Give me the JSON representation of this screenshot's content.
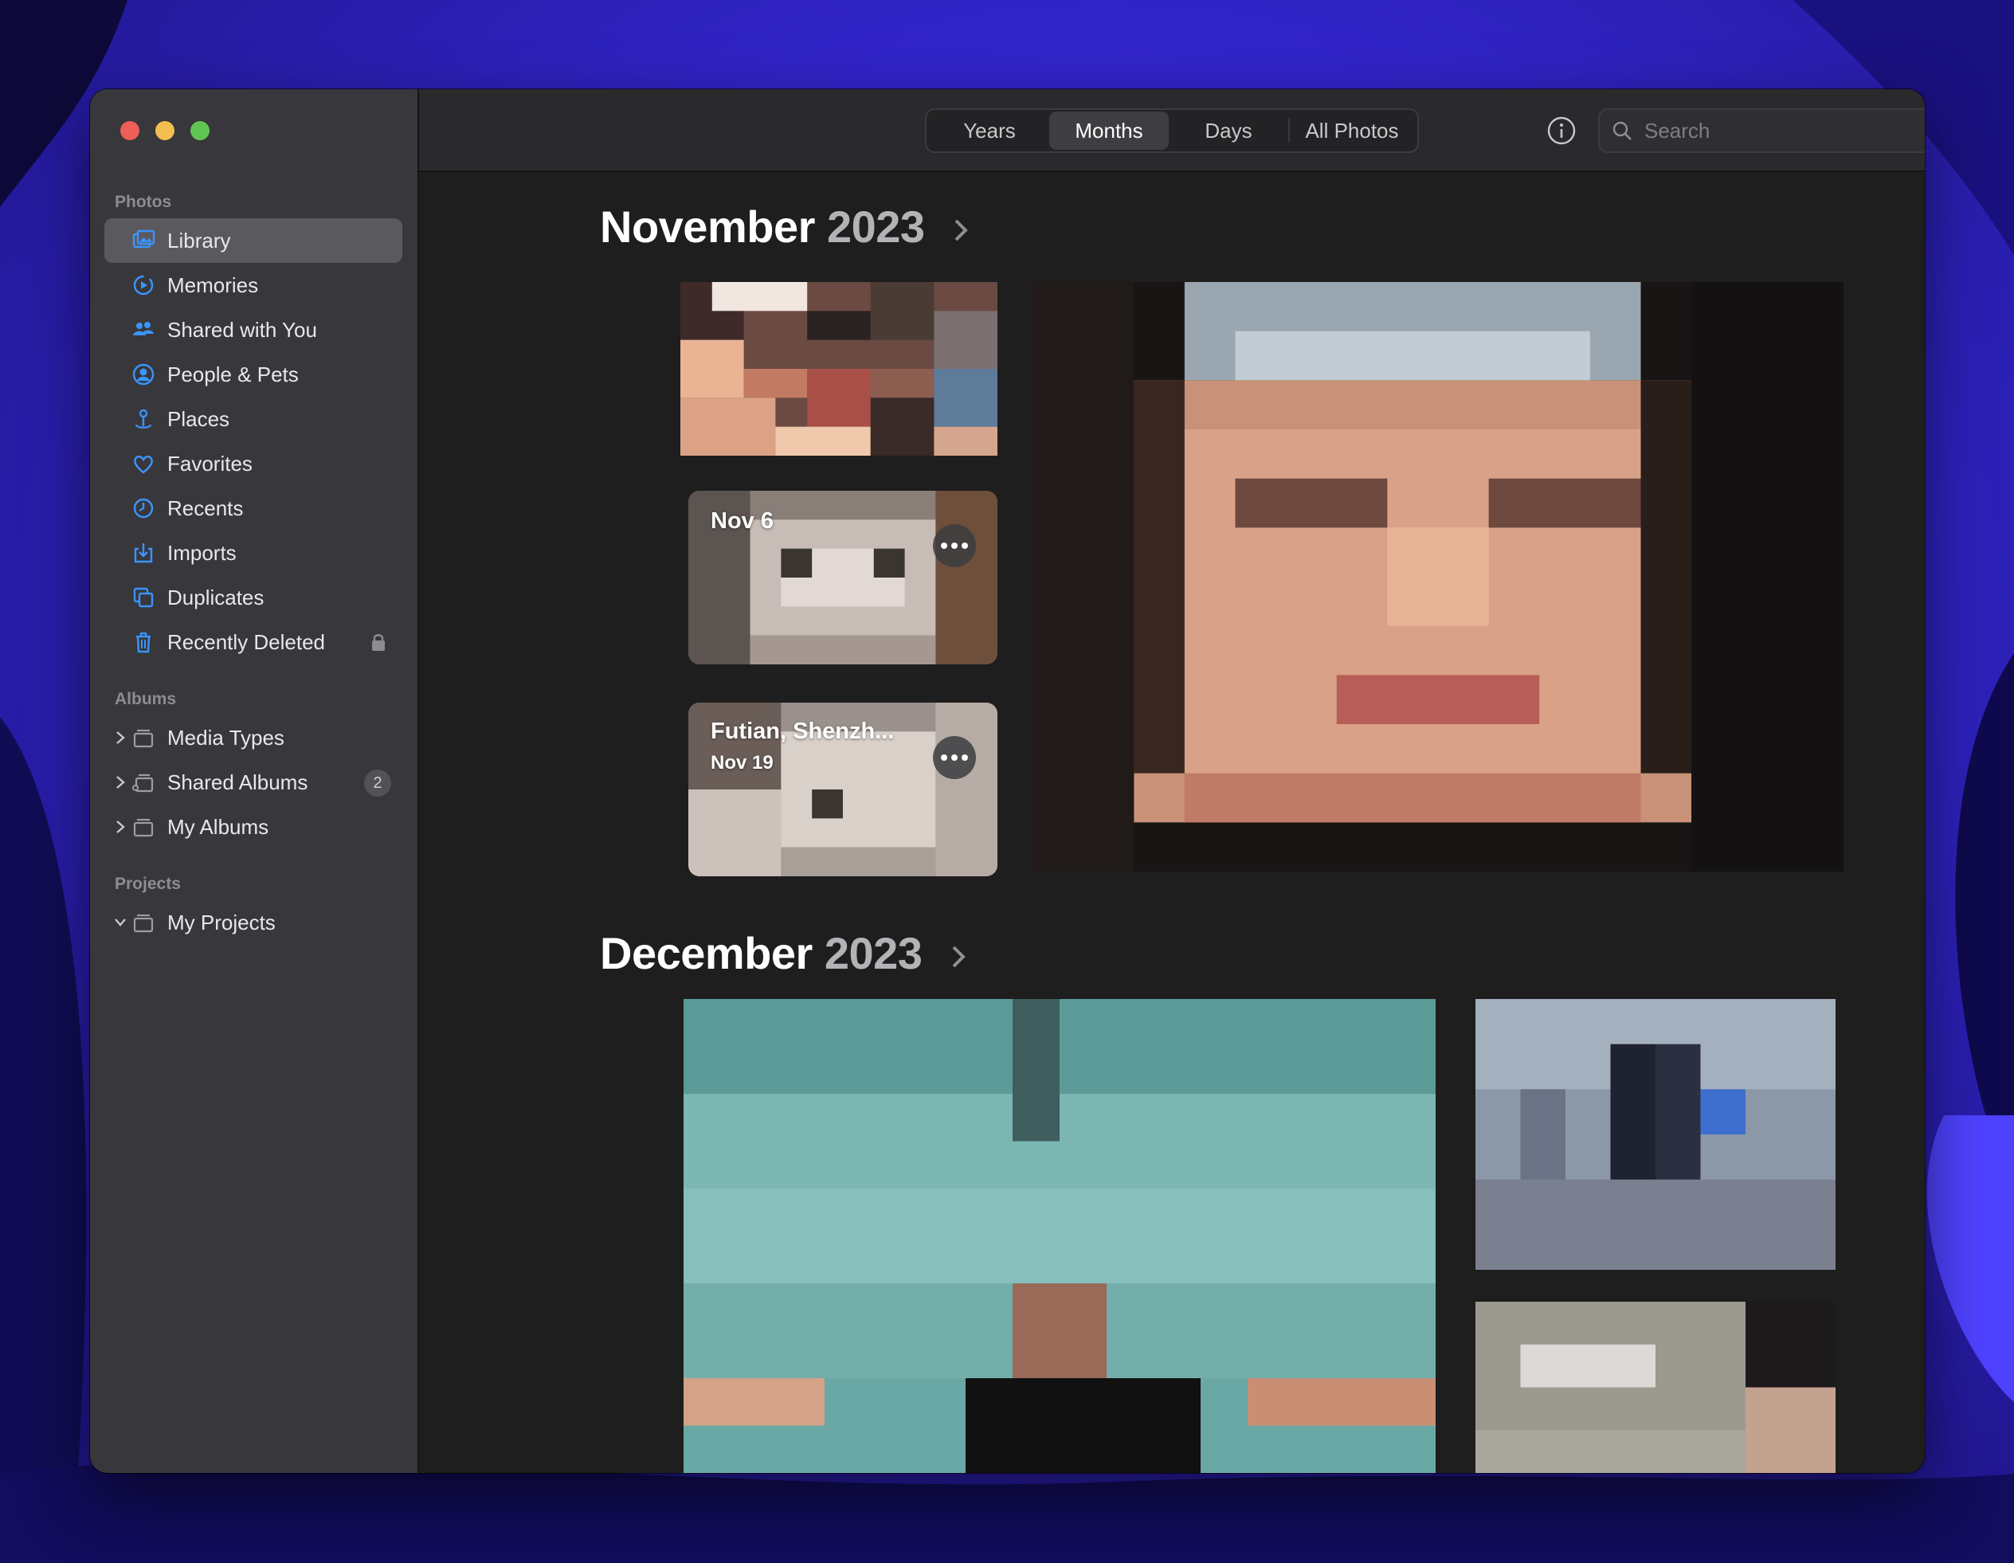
{
  "window": {
    "traffic_lights": [
      "close",
      "minimize",
      "zoom"
    ]
  },
  "sidebar": {
    "photos_section": "Photos",
    "items": [
      {
        "label": "Library",
        "icon": "library-icon"
      },
      {
        "label": "Memories",
        "icon": "memories-icon"
      },
      {
        "label": "Shared with You",
        "icon": "shared-with-you-icon"
      },
      {
        "label": "People & Pets",
        "icon": "people-icon"
      },
      {
        "label": "Places",
        "icon": "places-icon"
      },
      {
        "label": "Favorites",
        "icon": "heart-icon"
      },
      {
        "label": "Recents",
        "icon": "clock-icon"
      },
      {
        "label": "Imports",
        "icon": "import-icon"
      },
      {
        "label": "Duplicates",
        "icon": "duplicates-icon"
      },
      {
        "label": "Recently Deleted",
        "icon": "trash-icon"
      }
    ],
    "albums_section": "Albums",
    "albums": [
      {
        "label": "Media Types",
        "icon": "album-stack-icon"
      },
      {
        "label": "Shared Albums",
        "icon": "shared-album-icon",
        "badge": "2"
      },
      {
        "label": "My Albums",
        "icon": "album-stack-icon"
      }
    ],
    "projects_section": "Projects",
    "projects": [
      {
        "label": "My Projects",
        "icon": "album-stack-icon"
      }
    ]
  },
  "toolbar": {
    "tabs": [
      "Years",
      "Months",
      "Days",
      "All Photos"
    ],
    "selected_tab": "Months",
    "search_placeholder": "Search"
  },
  "content": {
    "months": [
      {
        "month": "November",
        "year": "2023"
      },
      {
        "month": "December",
        "year": "2023"
      }
    ],
    "cards": [
      {
        "title": "Nov 6"
      },
      {
        "title": "Futian, Shenzh...",
        "subtitle": "Nov 19"
      }
    ]
  },
  "colors": {
    "accent": "#2e8cff",
    "sidebar_bg": "#38373c",
    "content_bg": "#1e1e1e",
    "toolbar_bg": "#2a2a2d"
  }
}
